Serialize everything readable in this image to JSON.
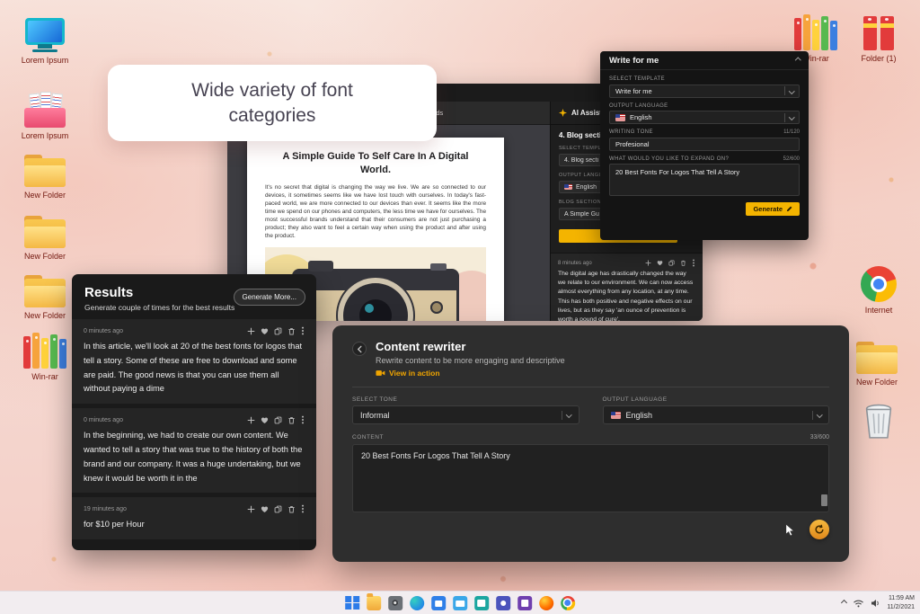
{
  "callout": {
    "text": "Wide variety of font categories"
  },
  "desktop": {
    "left_icons": [
      {
        "label": "Lorem Ipsum"
      },
      {
        "label": "Lorem Ipsum"
      },
      {
        "label": "New Folder"
      },
      {
        "label": "New Folder"
      },
      {
        "label": "New Folder"
      },
      {
        "label": "Win-rar"
      }
    ],
    "right_icons": [
      {
        "label": "Win-rar"
      },
      {
        "label": "Folder (1)"
      },
      {
        "label": "Internet"
      },
      {
        "label": "New Folder"
      }
    ]
  },
  "editor": {
    "toolbar": {
      "word_count": "0 words"
    },
    "assistant": {
      "title": "AI Assistant"
    },
    "document": {
      "title": "A Simple Guide To Self Care In A Digital World.",
      "body": "It's no secret that digital is changing the way we live. We are so connected to our devices, it sometimes seems like we have lost touch with ourselves. In today's fast-paced world, we are more connected to our devices than ever. It seems like the more time we spend on our phones and computers, the less time we have for ourselves. The most successful brands understand that their consumers are not just purchasing a product; they also want to feel a certain way when using the product and after using the product."
    },
    "sidebar": {
      "section_heading": "4. Blog secti",
      "select_template_label": "SELECT TEMPLATE",
      "select_template_value": "4. Blog secti",
      "output_language_label": "OUTPUT LANGUAGE",
      "output_language_value": "English",
      "blog_title_label": "BLOG SECTION TITLE",
      "blog_title_value": "A Simple Gu",
      "result_card": {
        "time": "8 minutes ago",
        "text": "The digital age has drastically changed the way we relate to our environment. We can now access almost everything from any location, at any time. This has both positive and negative effects on our lives, but as they say 'an ounce of prevention is worth a pound of cure'."
      }
    }
  },
  "write_for_me": {
    "title": "Write for me",
    "select_template_label": "SELECT TEMPLATE",
    "select_template_value": "Write for me",
    "output_language_label": "OUTPUT LANGUAGE",
    "output_language_value": "English",
    "writing_tone_label": "WRITING TONE",
    "writing_tone_count": "11/120",
    "writing_tone_value": "Profesional",
    "expand_label": "WHAT WOULD YOU LIKE TO EXPAND ON?",
    "expand_count": "52/600",
    "expand_value": "20 Best Fonts For Logos That Tell A Story",
    "generate_label": "Generate"
  },
  "results": {
    "title": "Results",
    "subtitle": "Generate couple of times for the best results",
    "generate_more_label": "Generate More...",
    "items": [
      {
        "time": "0 minutes ago",
        "text": "In this article, we'll look at 20 of the best fonts for logos that tell a story. Some of these are free to download and some are paid. The good news is that you can use them all without paying a dime"
      },
      {
        "time": "0 minutes ago",
        "text": "In the beginning, we had to create our own content. We wanted to tell a story that was true to the history of both the brand and our company. It was a huge undertaking, but we knew it would be worth it in the"
      },
      {
        "time": "19 minutes ago",
        "text": "for $10 per Hour"
      }
    ]
  },
  "content_rewriter": {
    "title": "Content rewriter",
    "subtitle": "Rewrite content to be more engaging and descriptive",
    "view_in_action_label": "View in action",
    "select_tone_label": "SELECT TONE",
    "select_tone_value": "Informal",
    "output_language_label": "OUTPUT LANGUAGE",
    "output_language_value": "English",
    "content_label": "CONTENT",
    "content_count": "33/600",
    "content_value": "20 Best Fonts For Logos That Tell A Story"
  },
  "taskbar": {
    "time": "11:59 AM",
    "date": "11/2/2021"
  },
  "colors": {
    "accent_yellow": "#f4b400",
    "panel_dark": "#1e1e1e"
  }
}
